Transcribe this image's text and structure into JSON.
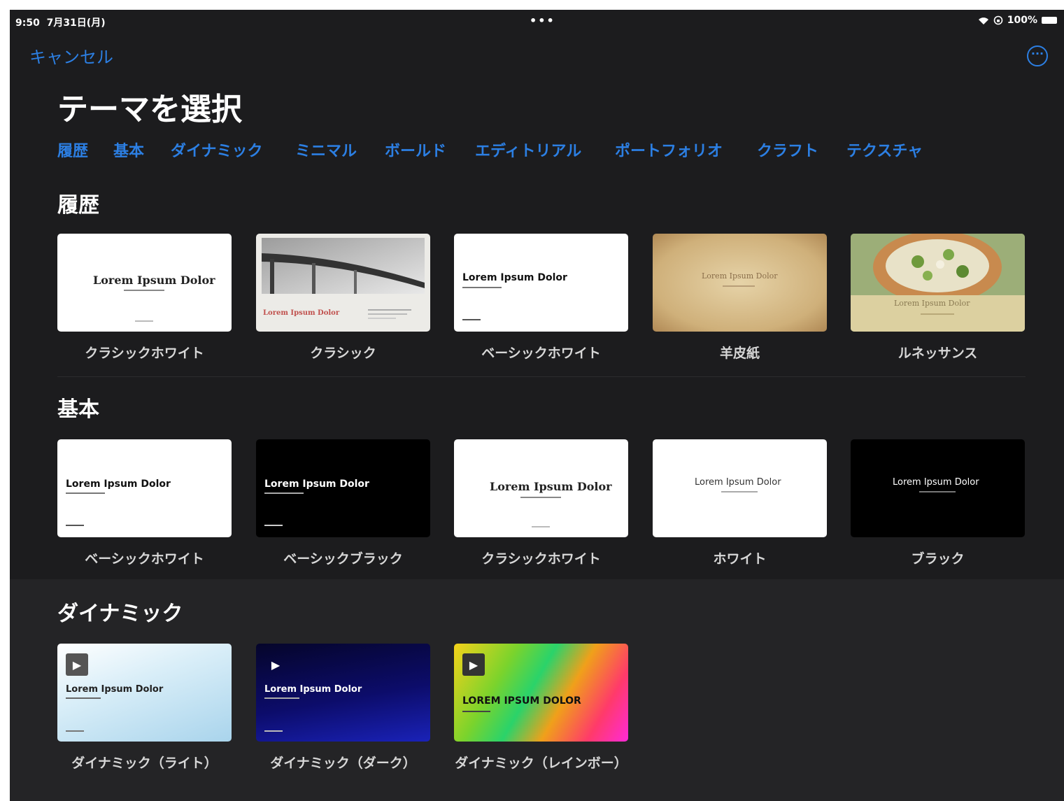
{
  "status": {
    "time": "9:50",
    "date": "7月31日(月)",
    "dots": "•••",
    "wifi": "wifi-icon",
    "lock": "rotation-lock-icon",
    "battery": "100%"
  },
  "nav": {
    "cancel": "キャンセル",
    "more_icon": "ellipsis-circle-icon"
  },
  "page_title": "テーマを選択",
  "tabs": [
    "履歴",
    "基本",
    "ダイナミック",
    "ミニマル",
    "ボールド",
    "エディトリアル",
    "ポートフォリオ",
    "クラフト",
    "テクスチャ"
  ],
  "sections": {
    "recent": {
      "title": "履歴",
      "themes": [
        "クラシックホワイト",
        "クラシック",
        "ベーシックホワイト",
        "羊皮紙",
        "ルネッサンス"
      ]
    },
    "basic": {
      "title": "基本",
      "themes": [
        "ベーシックホワイト",
        "ベーシックブラック",
        "クラシックホワイト",
        "ホワイト",
        "ブラック"
      ]
    },
    "dynamic": {
      "title": "ダイナミック",
      "themes": [
        "ダイナミック（ライト）",
        "ダイナミック（ダーク）",
        "ダイナミック（レインボー）"
      ]
    }
  },
  "thumb_text": {
    "lorem": "Lorem Ipsum Dolor",
    "lorem_caps": "LOREM IPSUM DOLOR"
  },
  "colors": {
    "accent": "#2c7fe3",
    "background": "#1c1c1e"
  }
}
